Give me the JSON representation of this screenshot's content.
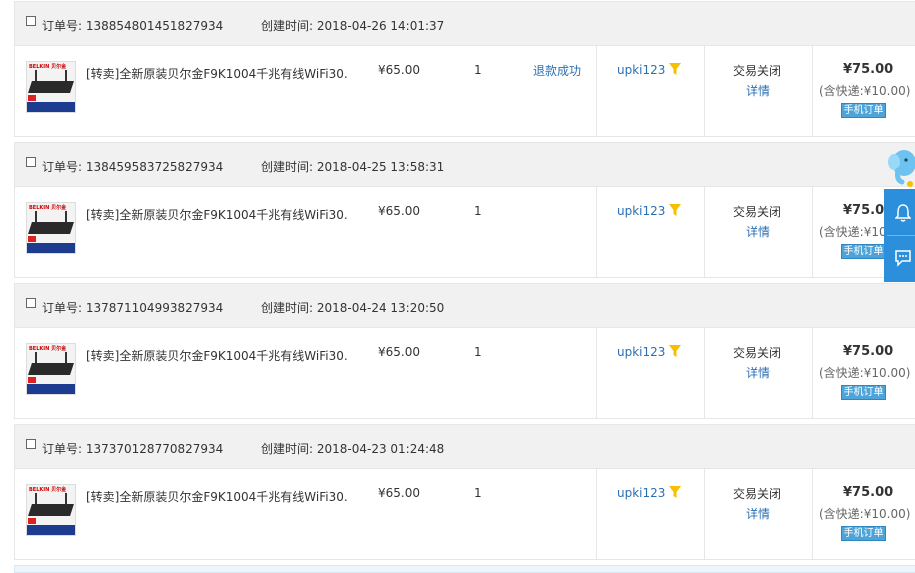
{
  "labels": {
    "order_no_prefix": "订单号: ",
    "created_prefix": "创建时间: ",
    "detail_link": "详情",
    "mobile_order_button": "手机订单"
  },
  "colors": {
    "link": "#2b6fb3",
    "button": "#4ea4d9",
    "side_panel": "#2b8fdc",
    "filter_icon": "#f5c000"
  },
  "icons": {
    "filter": "filter-icon",
    "bell": "bell-icon",
    "chat": "chat-icon",
    "mascot": "elephant-mascot-icon"
  },
  "orders": [
    {
      "order_no": "订单号: 138854801451827934",
      "created": "创建时间: 2018-04-26 14:01:37",
      "item_title": "[转卖]全新原装贝尔金F9K1004千兆有线WiFi30...",
      "price": "¥65.00",
      "qty": "1",
      "refund_status": "退款成功",
      "seller": "upki123",
      "status": "交易关闭",
      "detail": "详情",
      "total": "¥75.00",
      "shipping": "(含快递:¥10.00)",
      "button": "手机订单"
    },
    {
      "order_no": "订单号: 138459583725827934",
      "created": "创建时间: 2018-04-25 13:58:31",
      "item_title": "[转卖]全新原装贝尔金F9K1004千兆有线WiFi30...",
      "price": "¥65.00",
      "qty": "1",
      "refund_status": "",
      "seller": "upki123",
      "status": "交易关闭",
      "detail": "详情",
      "total": "¥75.00",
      "shipping": "(含快递:¥10.00)",
      "button": "手机订单"
    },
    {
      "order_no": "订单号: 137871104993827934",
      "created": "创建时间: 2018-04-24 13:20:50",
      "item_title": "[转卖]全新原装贝尔金F9K1004千兆有线WiFi30...",
      "price": "¥65.00",
      "qty": "1",
      "refund_status": "",
      "seller": "upki123",
      "status": "交易关闭",
      "detail": "详情",
      "total": "¥75.00",
      "shipping": "(含快递:¥10.00)",
      "button": "手机订单"
    },
    {
      "order_no": "订单号: 137370128770827934",
      "created": "创建时间: 2018-04-23 01:24:48",
      "item_title": "[转卖]全新原装贝尔金F9K1004千兆有线WiFi30...",
      "price": "¥65.00",
      "qty": "1",
      "refund_status": "",
      "seller": "upki123",
      "status": "交易关闭",
      "detail": "详情",
      "total": "¥75.00",
      "shipping": "(含快递:¥10.00)",
      "button": "手机订单"
    }
  ]
}
